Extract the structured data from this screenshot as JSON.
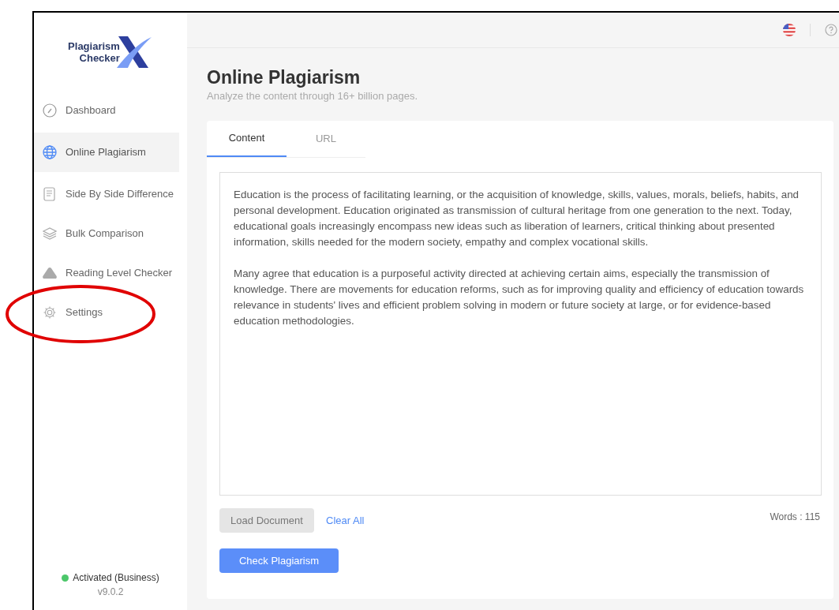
{
  "logo": {
    "line_1": "Plagiarism",
    "line_2": "Checker"
  },
  "sidebar": {
    "items": [
      {
        "label": "Dashboard",
        "selected": false
      },
      {
        "label": "Online Plagiarism",
        "selected": true
      },
      {
        "label": "Side By Side Difference",
        "selected": false
      },
      {
        "label": "Bulk Comparison",
        "selected": false
      },
      {
        "label": "Reading Level Checker",
        "selected": false
      },
      {
        "label": "Settings",
        "selected": false
      }
    ],
    "status": {
      "label": "Activated (Business)",
      "color": "#4cc76a",
      "version": "v9.0.2"
    }
  },
  "annotation": {
    "kind": "ellipse",
    "color": "#e00000"
  },
  "header": {
    "title": "Online Plagiarism",
    "subtitle": "Analyze the content through 16+ billion pages."
  },
  "tabs": [
    {
      "label": "Content",
      "selected": true
    },
    {
      "label": "URL",
      "selected": false
    }
  ],
  "editor": {
    "paragraphs": [
      "Education is the process of facilitating learning, or the acquisition of knowledge, skills, values, morals, beliefs, habits, and personal development. Education originated as transmission of cultural heritage from one generation to the next. Today, educational goals increasingly encompass new ideas such as liberation of learners, critical thinking about presented information, skills needed for the modern society, empathy and complex vocational skills.",
      "Many agree that education is a purposeful activity directed at achieving certain aims, especially the transmission of knowledge. There are movements for education reforms, such as for improving quality and efficiency of education towards relevance in students' lives and efficient problem solving in modern or future society at large, or for evidence-based education methodologies."
    ]
  },
  "load_button": "Load Document",
  "clear_link": "Clear All",
  "word_count": "Words : 115",
  "check_button": "Check Plagiarism"
}
